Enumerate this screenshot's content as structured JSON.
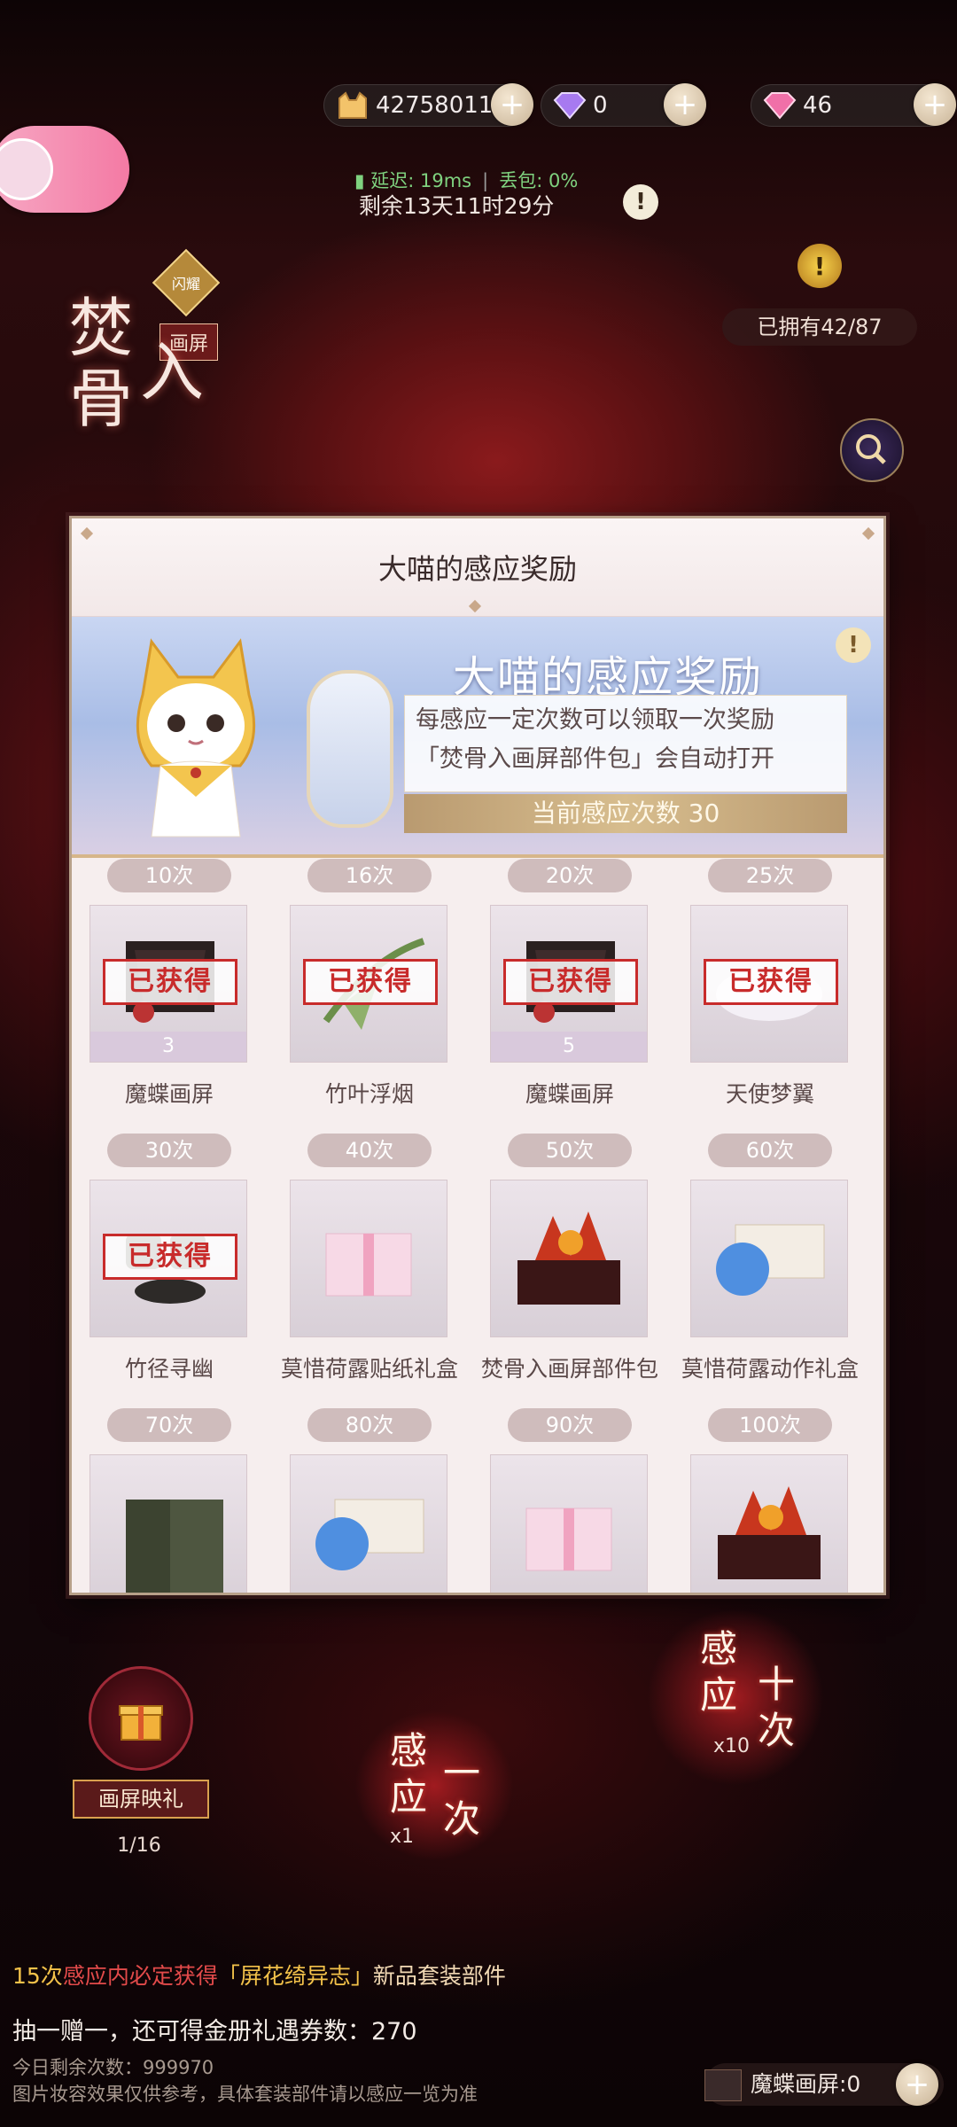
{
  "currencies": [
    {
      "icon": "cat-coin-icon",
      "value": "42758011"
    },
    {
      "icon": "purple-diamond-icon",
      "value": "0"
    },
    {
      "icon": "pink-diamond-icon",
      "value": "46"
    }
  ],
  "network": {
    "latency": "延迟: 19ms",
    "loss": "丢包: 0%"
  },
  "timer": "剩余13天11时29分",
  "event": {
    "title_chars": [
      "焚",
      "骨",
      "入",
      "画"
    ],
    "tag_limited": "闪耀",
    "tag_type": "画屏",
    "owned": "已拥有42/87"
  },
  "modal": {
    "title": "大喵的感应奖励",
    "banner_title": "大喵的感应奖励",
    "banner_desc_1": "每感应一定次数可以领取一次奖励",
    "banner_desc_2": "「焚骨入画屏部件包」会自动打开",
    "banner_count": "当前感应次数 30",
    "rewards": [
      {
        "count": "10次",
        "label": "魔蝶画屏",
        "obtained": true,
        "obtained_text": "已获得",
        "qty": "3"
      },
      {
        "count": "16次",
        "label": "竹叶浮烟",
        "obtained": true,
        "obtained_text": "已获得",
        "qty": ""
      },
      {
        "count": "20次",
        "label": "魔蝶画屏",
        "obtained": true,
        "obtained_text": "已获得",
        "qty": "5"
      },
      {
        "count": "25次",
        "label": "天使梦翼",
        "obtained": true,
        "obtained_text": "已获得",
        "qty": ""
      },
      {
        "count": "30次",
        "label": "竹径寻幽",
        "obtained": true,
        "obtained_text": "已获得",
        "qty": ""
      },
      {
        "count": "40次",
        "label": "莫惜荷露贴纸礼盒",
        "obtained": false,
        "obtained_text": "",
        "qty": ""
      },
      {
        "count": "50次",
        "label": "焚骨入画屏部件包",
        "obtained": false,
        "obtained_text": "",
        "qty": ""
      },
      {
        "count": "60次",
        "label": "莫惜荷露动作礼盒",
        "obtained": false,
        "obtained_text": "",
        "qty": ""
      },
      {
        "count": "70次",
        "label": "",
        "obtained": false,
        "obtained_text": "",
        "qty": ""
      },
      {
        "count": "80次",
        "label": "",
        "obtained": false,
        "obtained_text": "",
        "qty": ""
      },
      {
        "count": "90次",
        "label": "",
        "obtained": false,
        "obtained_text": "",
        "qty": ""
      },
      {
        "count": "100次",
        "label": "",
        "obtained": false,
        "obtained_text": "",
        "qty": ""
      }
    ]
  },
  "gift": {
    "label": "画屏映礼",
    "count": "1/16"
  },
  "draw_one": {
    "chars": [
      "感",
      "应",
      "一",
      "次"
    ],
    "cost": "x1"
  },
  "draw_ten": {
    "chars": [
      "感",
      "应",
      "十",
      "次"
    ],
    "cost": "x10"
  },
  "info": {
    "line1_a": "15次",
    "line1_b": "感应内必定获得",
    "line1_c": "「屏花绮异志」",
    "line1_d": "新品套装部件",
    "line2": "抽一赠一，还可得金册礼遇券数：270",
    "line3": "今日剩余次数：999970",
    "line4": "图片妆容效果仅供参考，具体套装部件请以感应一览为准"
  },
  "bottom_item": "魔蝶画屏:0"
}
